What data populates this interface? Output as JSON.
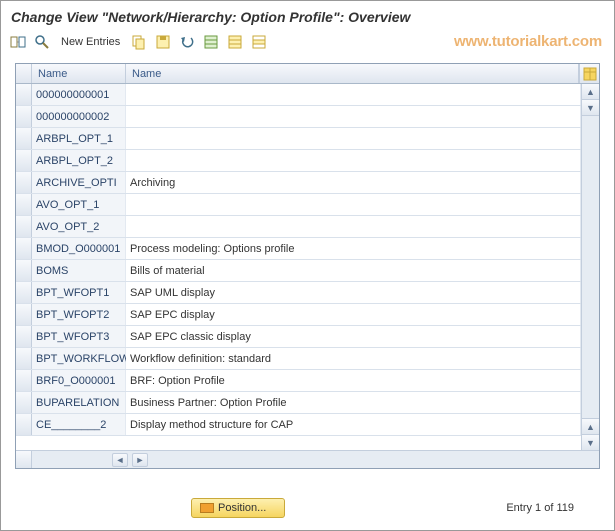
{
  "header": {
    "title": "Change View \"Network/Hierarchy: Option Profile\": Overview"
  },
  "toolbar": {
    "new_entries_label": "New Entries"
  },
  "watermark": "www.tutorialkart.com",
  "table": {
    "columns": [
      "Name",
      "Name"
    ],
    "rows": [
      {
        "code": "000000000001",
        "name": ""
      },
      {
        "code": "000000000002",
        "name": ""
      },
      {
        "code": "ARBPL_OPT_1",
        "name": ""
      },
      {
        "code": "ARBPL_OPT_2",
        "name": ""
      },
      {
        "code": "ARCHIVE_OPTI",
        "name": "Archiving"
      },
      {
        "code": "AVO_OPT_1",
        "name": ""
      },
      {
        "code": "AVO_OPT_2",
        "name": ""
      },
      {
        "code": "BMOD_O000001",
        "name": "Process modeling: Options profile"
      },
      {
        "code": "BOMS",
        "name": "Bills of material"
      },
      {
        "code": "BPT_WFOPT1",
        "name": "SAP UML display"
      },
      {
        "code": "BPT_WFOPT2",
        "name": "SAP EPC display"
      },
      {
        "code": "BPT_WFOPT3",
        "name": "SAP EPC classic display"
      },
      {
        "code": "BPT_WORKFLOW",
        "name": "Workflow definition: standard"
      },
      {
        "code": "BRF0_O000001",
        "name": "BRF: Option Profile"
      },
      {
        "code": "BUPARELATION",
        "name": "Business Partner: Option Profile"
      },
      {
        "code": "CE________2",
        "name": "Display method structure for CAP"
      }
    ]
  },
  "footer": {
    "position_label": "Position...",
    "entry_text": "Entry 1 of 119"
  }
}
